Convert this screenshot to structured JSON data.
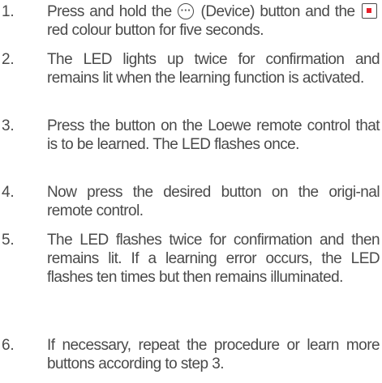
{
  "steps": [
    {
      "number": "1.",
      "segments": {
        "a": "Press and hold the ",
        "device_icon_glyph": "···",
        "b": " (Device) button and the ",
        "c": " red colour button for five seconds."
      },
      "icons": [
        "device-button-icon",
        "red-colour-button-icon"
      ],
      "icon_colors": {
        "red_button": "#e8202a"
      }
    },
    {
      "number": "2.",
      "text": "The LED lights up twice for confirmation and remains lit when the learning function is activated."
    },
    {
      "number": "3.",
      "text": "Press the button on the Loewe remote control that is to be learned. The LED flashes once."
    },
    {
      "number": "4.",
      "text": "Now press the desired button on the origi-nal remote control."
    },
    {
      "number": "5.",
      "text": "The LED flashes twice for confirmation and then remains lit. If a learning error occurs, the LED flashes ten times but then remains illuminated."
    },
    {
      "number": "6.",
      "text": "If necessary, repeat the procedure or learn more buttons according to step 3."
    }
  ],
  "colors": {
    "text": "#4a4a4a",
    "background": "#ffffff"
  }
}
